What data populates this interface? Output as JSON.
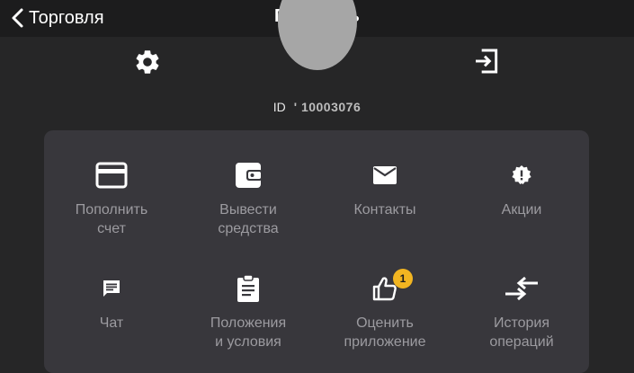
{
  "header": {
    "back_label": "Торговля",
    "title": "Профиль"
  },
  "profile": {
    "id_label": "ID",
    "id_value": "' 10003076"
  },
  "menu": [
    {
      "label": "Пополнить\nсчет",
      "icon": "credit-card-icon"
    },
    {
      "label": "Вывести\nсредства",
      "icon": "wallet-icon"
    },
    {
      "label": "Контакты",
      "icon": "mail-icon"
    },
    {
      "label": "Акции",
      "icon": "promo-badge-icon"
    },
    {
      "label": "Чат",
      "icon": "chat-icon"
    },
    {
      "label": "Положения\nи условия",
      "icon": "clipboard-icon"
    },
    {
      "label": "Оценить\nприложение",
      "icon": "thumbs-up-icon",
      "badge": "1"
    },
    {
      "label": "История\nопераций",
      "icon": "transfer-arrows-icon"
    }
  ],
  "colors": {
    "background": "#262627",
    "header": "#1c1c1d",
    "panel": "#38373c",
    "label": "#9c9ba0",
    "badge": "#f2b521",
    "avatar": "#a6a6a6"
  }
}
